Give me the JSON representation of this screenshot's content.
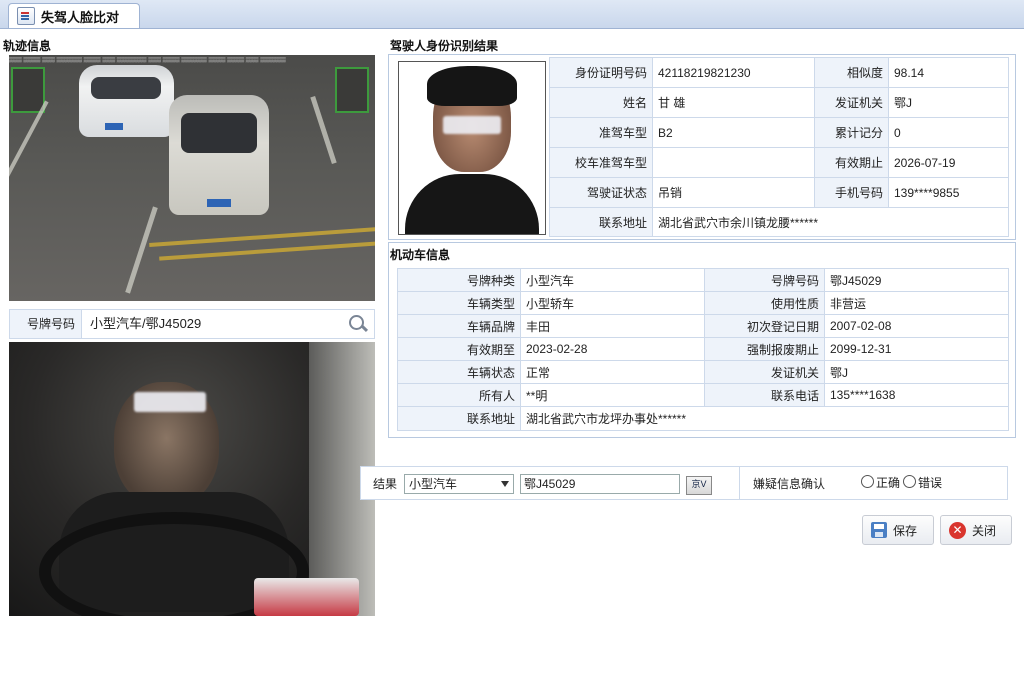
{
  "tab": {
    "title": "失驾人脸比对"
  },
  "track": {
    "title": "轨迹信息",
    "plate_label": "号牌号码",
    "plate_value": "小型汽车/鄂J45029"
  },
  "identity": {
    "title": "驾驶人身份识别结果",
    "rows": [
      {
        "k1": "身份证明号码",
        "v1": "42118219821230",
        "k2": "相似度",
        "v2": "98.14"
      },
      {
        "k1": "姓名",
        "v1": "甘 雄",
        "k2": "发证机关",
        "v2": "鄂J"
      },
      {
        "k1": "准驾车型",
        "v1": "B2",
        "k2": "累计记分",
        "v2": "0"
      },
      {
        "k1": "校车准驾车型",
        "v1": "",
        "k2": "有效期止",
        "v2": "2026-07-19"
      },
      {
        "k1": "驾驶证状态",
        "v1": "吊销",
        "k2": "手机号码",
        "v2": "139****9855"
      }
    ],
    "address_label": "联系地址",
    "address_value": "湖北省武穴市余川镇龙腰******"
  },
  "vehicle": {
    "title": "机动车信息",
    "rows": [
      {
        "k1": "号牌种类",
        "v1": "小型汽车",
        "k2": "号牌号码",
        "v2": "鄂J45029"
      },
      {
        "k1": "车辆类型",
        "v1": "小型轿车",
        "k2": "使用性质",
        "v2": "非营运"
      },
      {
        "k1": "车辆品牌",
        "v1": "丰田",
        "k2": "初次登记日期",
        "v2": "2007-02-08"
      },
      {
        "k1": "有效期至",
        "v1": "2023-02-28",
        "k2": "强制报废期止",
        "v2": "2099-12-31"
      },
      {
        "k1": "车辆状态",
        "v1": "正常",
        "k2": "发证机关",
        "v2": "鄂J"
      },
      {
        "k1": "所有人",
        "v1": "**明",
        "k2": "联系电话",
        "v2": "135****1638"
      }
    ],
    "address_label": "联系地址",
    "address_value": "湖北省武穴市龙坪办事处******"
  },
  "result": {
    "label": "结果",
    "plate_type": "小型汽车",
    "plate_number": "鄂J45029",
    "verify_label": "京V",
    "confirm_label": "嫌疑信息确认",
    "option_correct": "正确",
    "option_wrong": "错误"
  },
  "actions": {
    "save": "保存",
    "close": "关闭"
  },
  "colors": {
    "header": "#dfe8f5",
    "label_bg": "#eef3fa",
    "border": "#cdd9ea",
    "close_icon": "#d9352e"
  }
}
